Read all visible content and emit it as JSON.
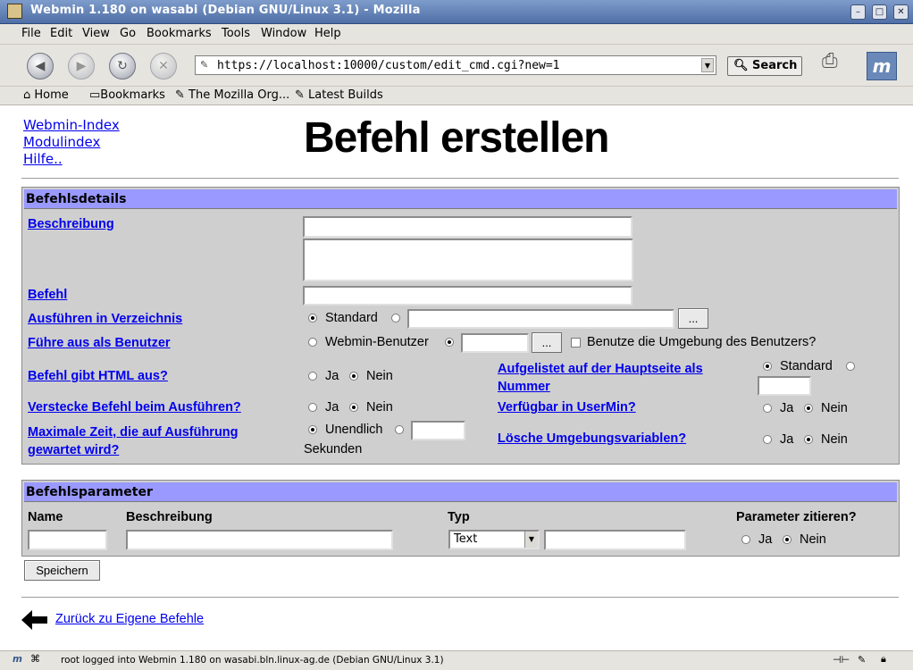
{
  "window": {
    "title": "Webmin 1.180 on wasabi (Debian GNU/Linux 3.1) - Mozilla"
  },
  "menu": [
    "File",
    "Edit",
    "View",
    "Go",
    "Bookmarks",
    "Tools",
    "Window",
    "Help"
  ],
  "nav": {
    "url": "https://localhost:10000/custom/edit_cmd.cgi?new=1",
    "search_label": "Search"
  },
  "bookmarks": [
    "Home",
    "Bookmarks",
    "The Mozilla Org...",
    "Latest Builds"
  ],
  "page": {
    "links": [
      "Webmin-Index",
      "Modulindex",
      "Hilfe.."
    ],
    "title": "Befehl erstellen"
  },
  "details": {
    "header": "Befehlsdetails",
    "beschreibung": "Beschreibung",
    "befehl": "Befehl",
    "verzeichnis": "Ausführen in Verzeichnis",
    "standard": "Standard",
    "benutzer": "Führe aus als Benutzer",
    "webmin_benutzer": "Webmin-Benutzer",
    "umgebung": "Benutze die Umgebung des Benutzers?",
    "html": "Befehl gibt HTML aus?",
    "ja": "Ja",
    "nein": "Nein",
    "aufgelistet": "Aufgelistet auf der Hauptseite als Nummer",
    "verstecke": "Verstecke Befehl beim Ausführen?",
    "usermin": "Verfügbar in UserMin?",
    "maxzeit": "Maximale Zeit, die auf Ausführung gewartet wird?",
    "unendlich": "Unendlich",
    "sekunden": "Sekunden",
    "loesche": "Lösche Umgebungsvariablen?",
    "browse": "..."
  },
  "params": {
    "header": "Befehlsparameter",
    "col_name": "Name",
    "col_beschreibung": "Beschreibung",
    "col_typ": "Typ",
    "col_zitieren": "Parameter zitieren?",
    "typ_selected": "Text",
    "ja": "Ja",
    "nein": "Nein"
  },
  "save_label": "Speichern",
  "back_link": "Zurück zu Eigene Befehle",
  "status": "root logged into Webmin 1.180 on wasabi.bln.linux-ag.de (Debian GNU/Linux 3.1)",
  "colors": {
    "section_header": "#9999ff",
    "panel_bg": "#cfcfcf",
    "link": "#0000ee"
  }
}
